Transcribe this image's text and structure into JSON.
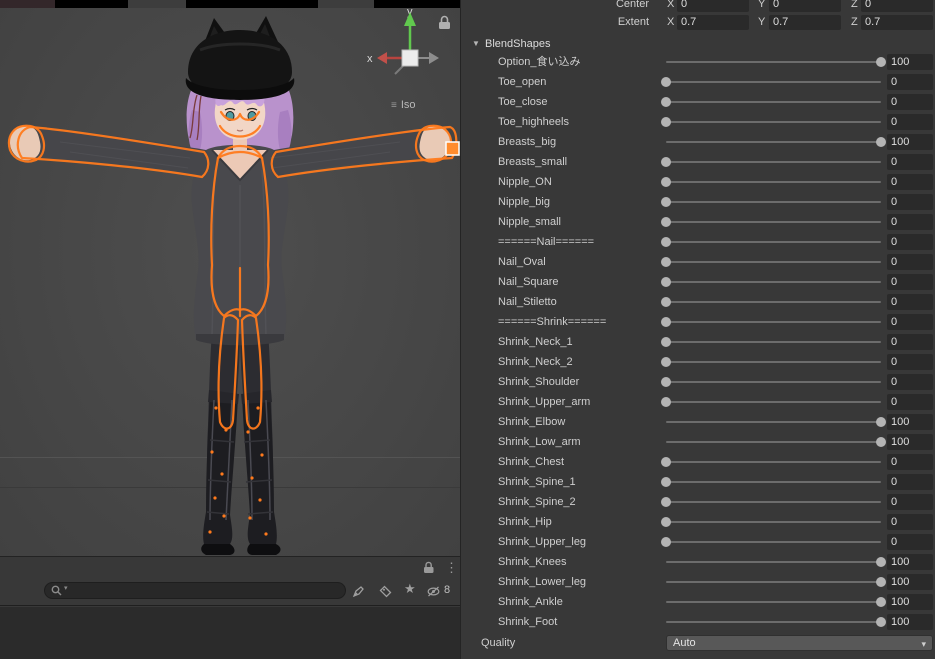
{
  "colors": {
    "accent_orange": "#ff7a1c",
    "panel_bg": "#383838",
    "field_bg": "#2a2a2a",
    "axis_green": "#61c84e",
    "axis_red": "#c1504a"
  },
  "icons": {
    "foldout": "▼",
    "dropdown_caret": "▾",
    "menu": "⋮",
    "star": "★",
    "iso_lines": "≡",
    "search": "magnifier",
    "lock": "padlock",
    "eye_hidden": "eye-slash",
    "tag": "tag",
    "paint": "pen"
  },
  "scene": {
    "gizmo": {
      "y_label": "y",
      "x_label": "x",
      "view_label": "Iso"
    },
    "toolbar": {
      "search_value": "",
      "hidden_count": "8"
    }
  },
  "inspector": {
    "bounds": {
      "axis_labels": {
        "x": "X",
        "y": "Y",
        "z": "Z"
      },
      "rows": [
        {
          "label": "Center",
          "x": "0",
          "y": "0",
          "z": "0"
        },
        {
          "label": "Extent",
          "x": "0.7",
          "y": "0.7",
          "z": "0.7"
        }
      ]
    },
    "blendshapes_label": "BlendShapes",
    "blendshapes": [
      {
        "label": "Option_食い込み",
        "value": "100",
        "pct": 100
      },
      {
        "label": "Toe_open",
        "value": "0",
        "pct": 0
      },
      {
        "label": "Toe_close",
        "value": "0",
        "pct": 0
      },
      {
        "label": "Toe_highheels",
        "value": "0",
        "pct": 0
      },
      {
        "label": "Breasts_big",
        "value": "100",
        "pct": 100
      },
      {
        "label": "Breasts_small",
        "value": "0",
        "pct": 0
      },
      {
        "label": "Nipple_ON",
        "value": "0",
        "pct": 0
      },
      {
        "label": "Nipple_big",
        "value": "0",
        "pct": 0
      },
      {
        "label": "Nipple_small",
        "value": "0",
        "pct": 0
      },
      {
        "label": "======Nail======",
        "value": "0",
        "pct": 0
      },
      {
        "label": "Nail_Oval",
        "value": "0",
        "pct": 0
      },
      {
        "label": "Nail_Square",
        "value": "0",
        "pct": 0
      },
      {
        "label": "Nail_Stiletto",
        "value": "0",
        "pct": 0
      },
      {
        "label": "======Shrink======",
        "value": "0",
        "pct": 0
      },
      {
        "label": "Shrink_Neck_1",
        "value": "0",
        "pct": 0
      },
      {
        "label": "Shrink_Neck_2",
        "value": "0",
        "pct": 0
      },
      {
        "label": "Shrink_Shoulder",
        "value": "0",
        "pct": 0
      },
      {
        "label": "Shrink_Upper_arm",
        "value": "0",
        "pct": 0
      },
      {
        "label": "Shrink_Elbow",
        "value": "100",
        "pct": 100
      },
      {
        "label": "Shrink_Low_arm",
        "value": "100",
        "pct": 100
      },
      {
        "label": "Shrink_Chest",
        "value": "0",
        "pct": 0
      },
      {
        "label": "Shrink_Spine_1",
        "value": "0",
        "pct": 0
      },
      {
        "label": "Shrink_Spine_2",
        "value": "0",
        "pct": 0
      },
      {
        "label": "Shrink_Hip",
        "value": "0",
        "pct": 0
      },
      {
        "label": "Shrink_Upper_leg",
        "value": "0",
        "pct": 0
      },
      {
        "label": "Shrink_Knees",
        "value": "100",
        "pct": 100
      },
      {
        "label": "Shrink_Lower_leg",
        "value": "100",
        "pct": 100
      },
      {
        "label": "Shrink_Ankle",
        "value": "100",
        "pct": 100
      },
      {
        "label": "Shrink_Foot",
        "value": "100",
        "pct": 100
      }
    ],
    "quality": {
      "label": "Quality",
      "value": "Auto"
    }
  }
}
